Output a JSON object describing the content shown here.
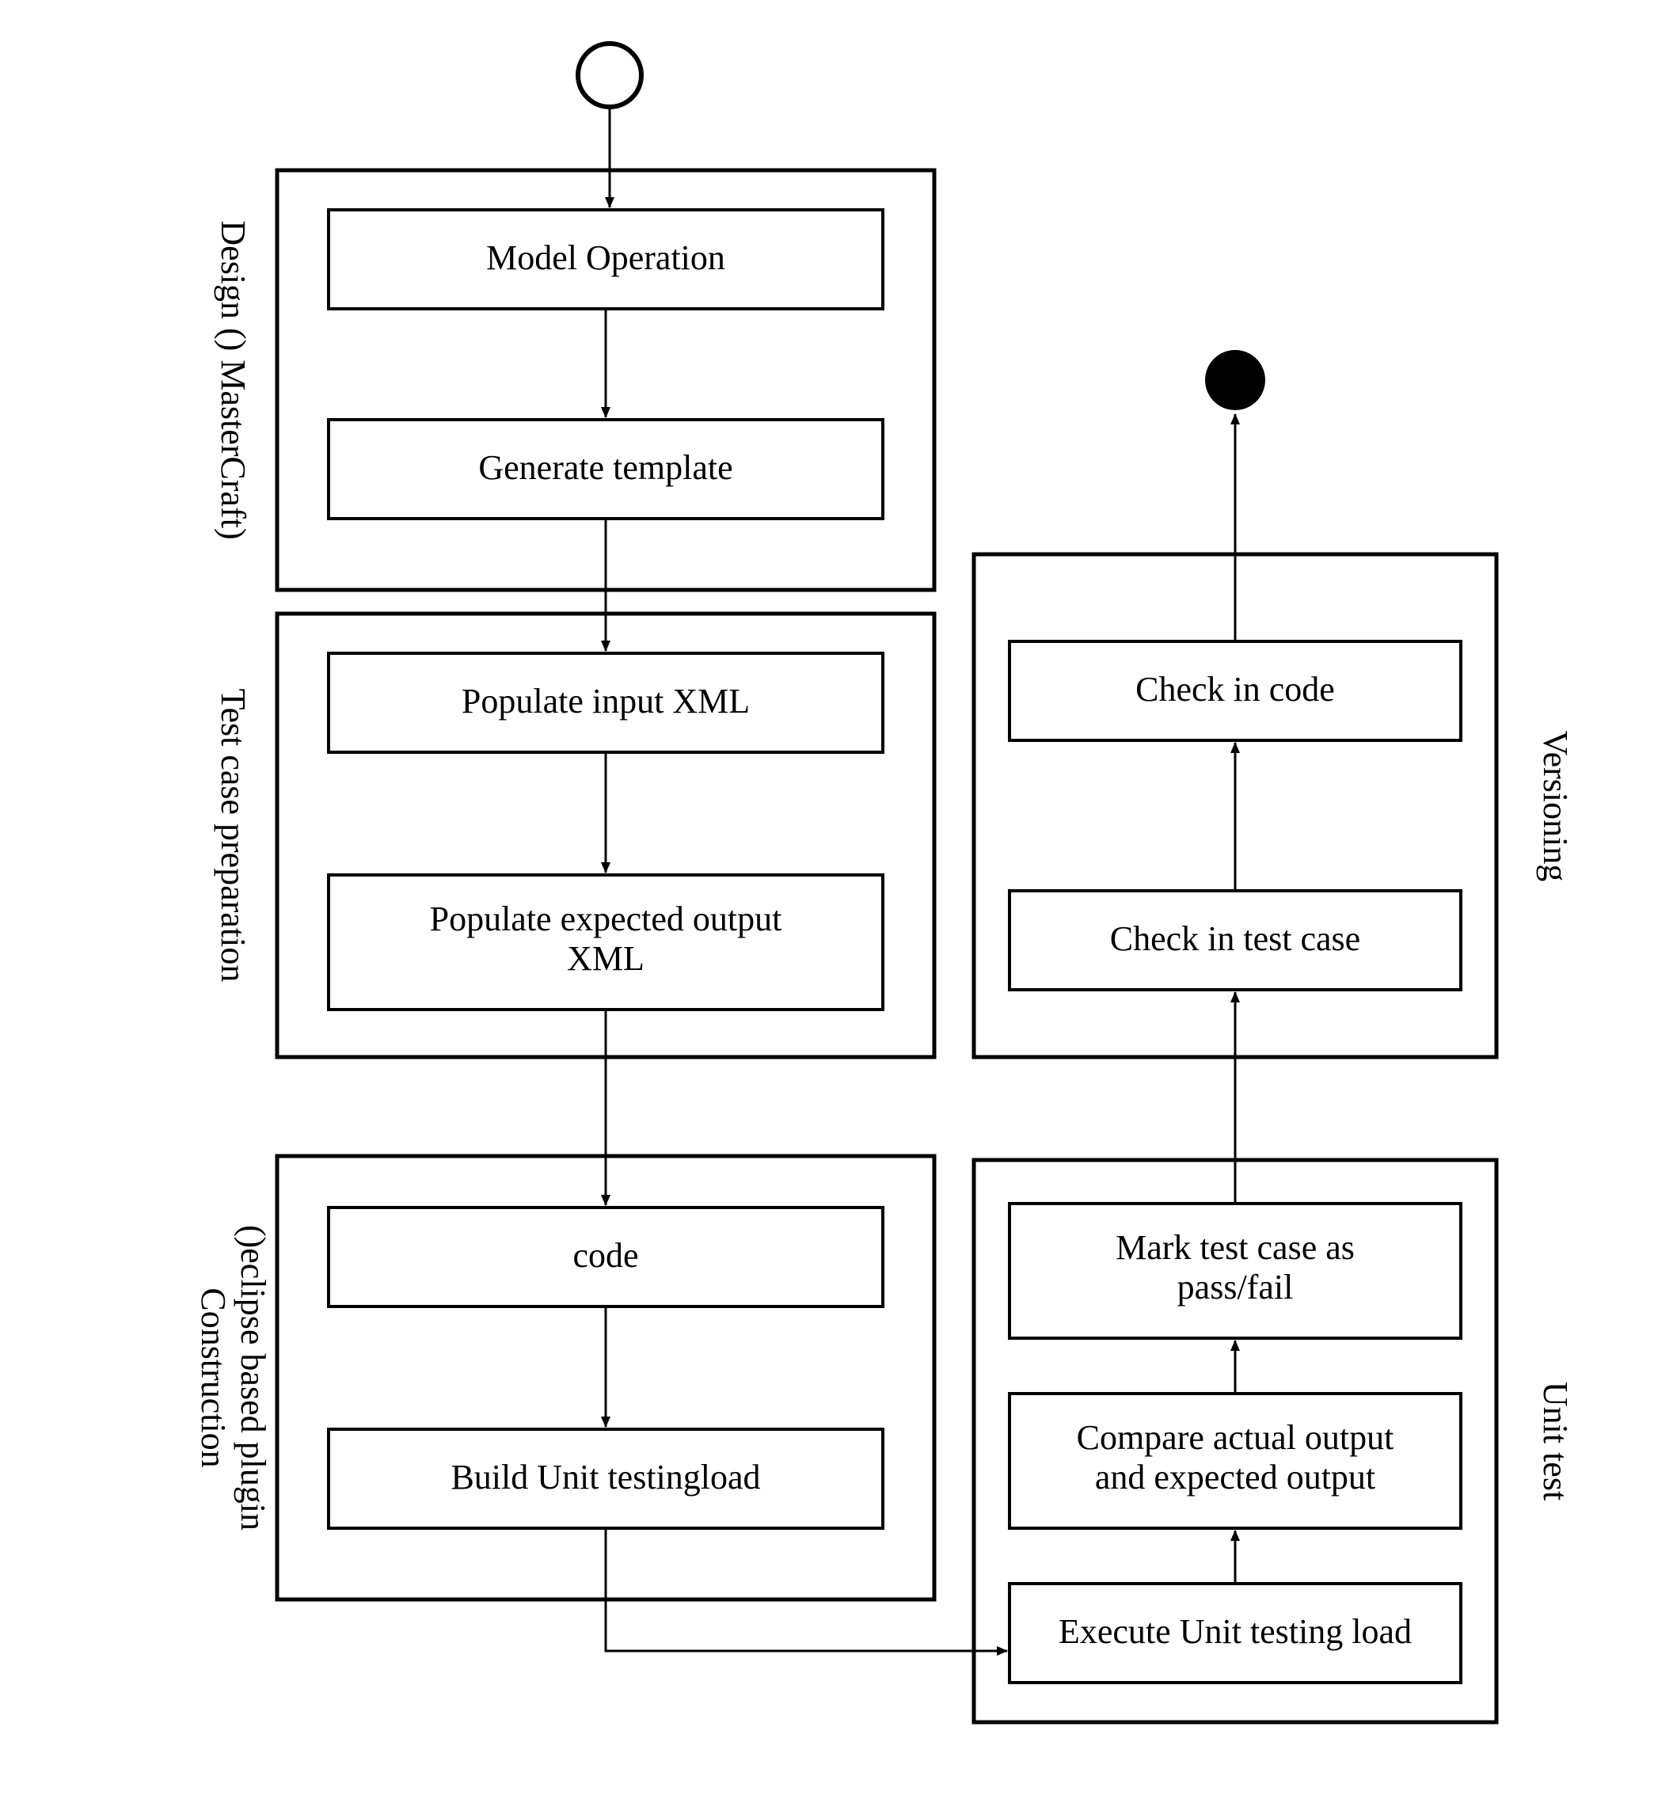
{
  "nodes": {
    "model_operation": "Model Operation",
    "generate_template": "Generate  template",
    "populate_input": "Populate input XML",
    "populate_output_l1": "Populate expected output",
    "populate_output_l2": "XML",
    "code": "code",
    "build_unit": "Build Unit testingload",
    "execute_unit": "Execute Unit testing load",
    "compare_l1": "Compare actual output",
    "compare_l2": "and expected output",
    "mark_l1": "Mark test case as",
    "mark_l2": "pass/fail",
    "check_in_tc": "Check in test case",
    "check_in_code": "Check in code"
  },
  "groups": {
    "design_l1": "Design () MasterCraft)",
    "testcase_l1": "Test case preparation",
    "construction_l1": "Construction",
    "construction_l2": "()eclipse based plugin",
    "unit_test": "Unit test",
    "versioning": "Versioning"
  }
}
